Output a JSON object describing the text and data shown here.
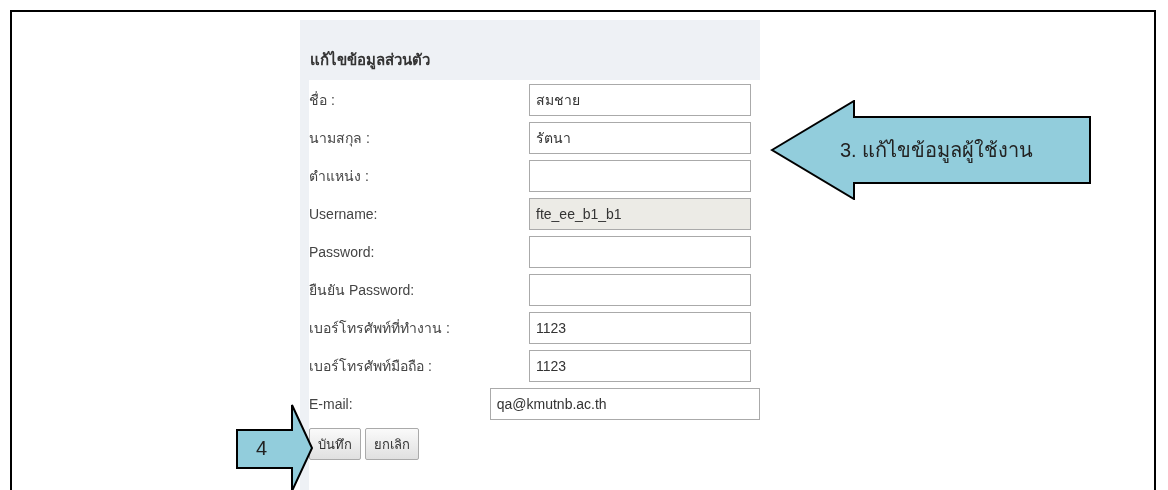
{
  "form": {
    "title": "แก้ไขข้อมูลส่วนตัว",
    "fields": [
      {
        "label": "ชื่อ :",
        "value": "สมชาย",
        "kind": "text",
        "disabled": false
      },
      {
        "label": "นามสกุล :",
        "value": "รัตนา",
        "kind": "text",
        "disabled": false
      },
      {
        "label": "ตำแหน่ง :",
        "kind": "text",
        "disabled": false
      },
      {
        "label": "Username:",
        "value": "fte_ee_b1_b1",
        "kind": "text",
        "disabled": true
      },
      {
        "label": "Password:",
        "kind": "text",
        "disabled": false
      },
      {
        "label": "ยืนยัน Password:",
        "kind": "text",
        "disabled": false
      },
      {
        "label": "เบอร์โทรศัพท์ที่ทำงาน :",
        "value": "1123",
        "kind": "text",
        "disabled": false
      },
      {
        "label": "เบอร์โทรศัพท์มือถือ :",
        "value": "1123",
        "kind": "text",
        "disabled": false
      },
      {
        "label": "E-mail:",
        "value": "qa@kmutnb.ac.th",
        "kind": "email",
        "disabled": false
      }
    ],
    "buttons": [
      "บันทึก",
      "ยกเลิก"
    ]
  },
  "callouts": [
    {
      "text": "3. แก้ไขข้อมูลผู้ใช้งาน",
      "kind": "left"
    },
    {
      "text": "4",
      "kind": "right"
    }
  ]
}
